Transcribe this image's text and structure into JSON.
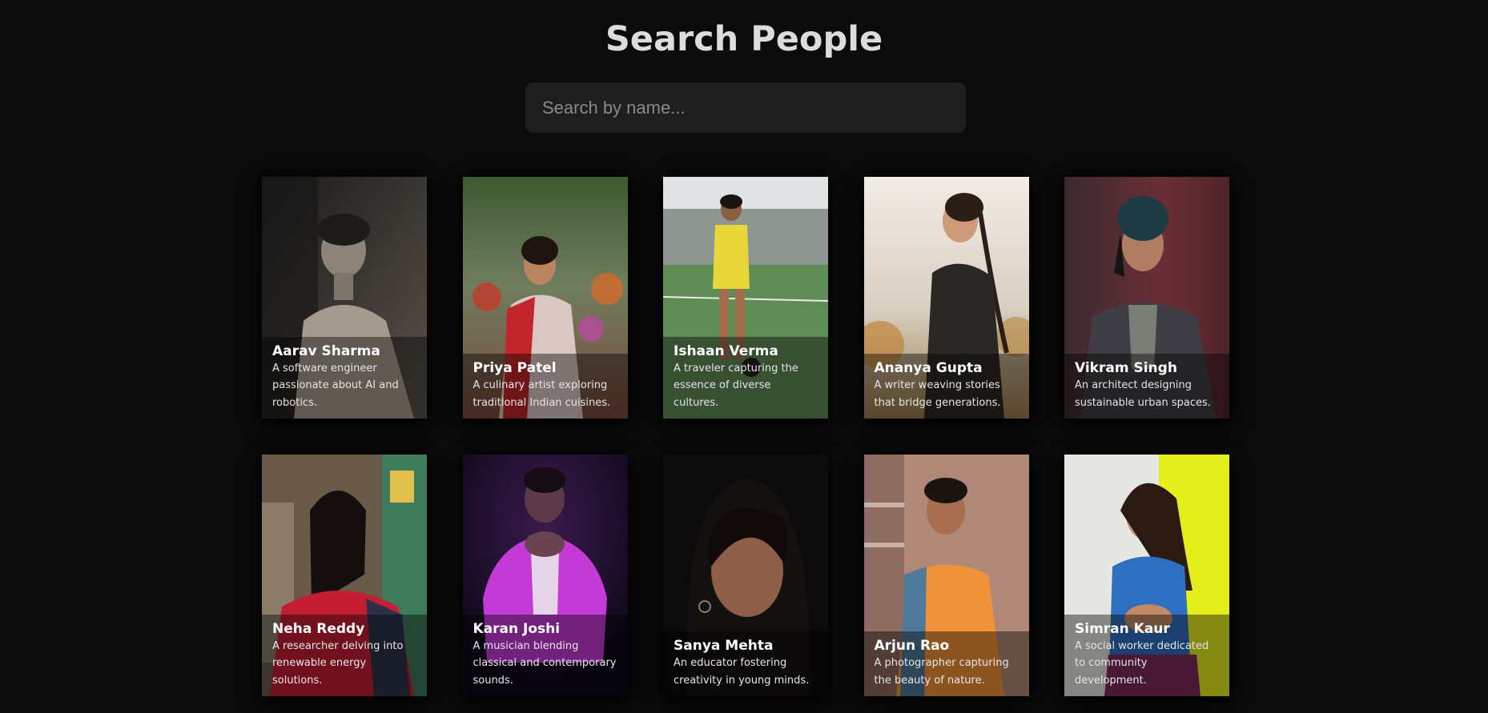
{
  "header": {
    "title": "Search People"
  },
  "search": {
    "placeholder": "Search by name...",
    "value": ""
  },
  "people": [
    {
      "name": "Aarav Sharma",
      "description": "A software engineer passionate about AI and robotics."
    },
    {
      "name": "Priya Patel",
      "description": "A culinary artist exploring traditional Indian cuisines."
    },
    {
      "name": "Ishaan Verma",
      "description": "A traveler capturing the essence of diverse cultures."
    },
    {
      "name": "Ananya Gupta",
      "description": "A writer weaving stories that bridge generations."
    },
    {
      "name": "Vikram Singh",
      "description": "An architect designing sustainable urban spaces."
    },
    {
      "name": "Neha Reddy",
      "description": "A researcher delving into renewable energy solutions."
    },
    {
      "name": "Karan Joshi",
      "description": "A musician blending classical and contemporary sounds."
    },
    {
      "name": "Sanya Mehta",
      "description": "An educator fostering creativity in young minds."
    },
    {
      "name": "Arjun Rao",
      "description": "A photographer capturing the beauty of nature."
    },
    {
      "name": "Simran Kaur",
      "description": "A social worker dedicated to community development."
    }
  ]
}
